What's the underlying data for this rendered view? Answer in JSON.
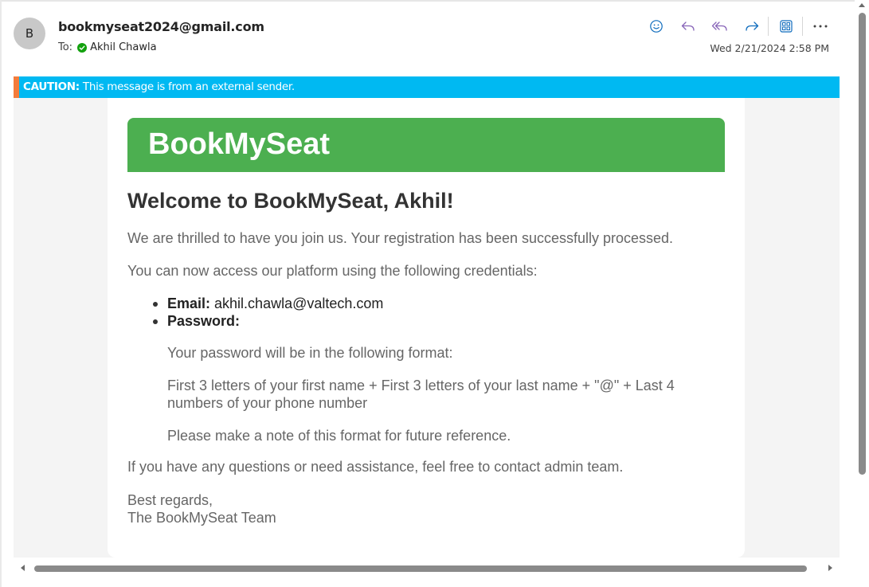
{
  "email": {
    "avatar_initial": "B",
    "sender": "bookmyseat2024@gmail.com",
    "to_label": "To:",
    "recipient": "Akhil Chawla",
    "date": "Wed 2/21/2024 2:58 PM",
    "actions": [
      "smiley-icon",
      "reply-icon",
      "reply-all-icon",
      "forward-icon",
      "immersive-reader-icon",
      "more-icon"
    ]
  },
  "caution": {
    "label": "CAUTION:",
    "text": " This message is from an external sender."
  },
  "message": {
    "brand": "BookMySeat",
    "welcome": "Welcome to BookMySeat, Akhil!",
    "intro": "We are thrilled to have you join us. Your registration has been successfully processed.",
    "access": "You can now access our platform using the following credentials:",
    "email_label": "Email:",
    "email_value": " akhil.chawla@valtech.com",
    "password_label": "Password:",
    "pw_format_intro": "Your password will be in the following format:",
    "pw_format": "First 3 letters of your first name + First 3 letters of your last name + \"@\" + Last 4 numbers of your phone number",
    "pw_note": "Please make a note of this format for future reference.",
    "help": "If you have any questions or need assistance, feel free to contact admin team.",
    "regards": "Best regards,",
    "signature": "The BookMySeat Team"
  },
  "colors": {
    "brand_green": "#4caf50",
    "caution_blue": "#00b9f2",
    "caution_accent": "#f47c3c",
    "icon_blue": "#0f6cbd",
    "verified_green": "#13a10e"
  }
}
